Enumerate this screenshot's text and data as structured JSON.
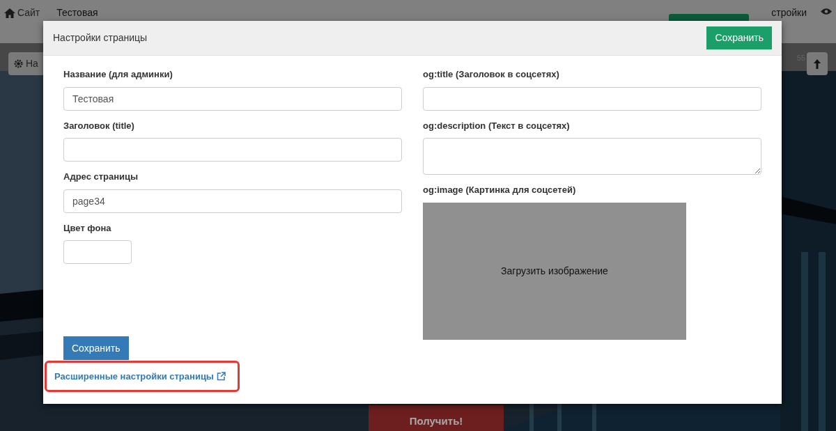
{
  "topbar": {
    "home": "Сайт",
    "page": "Тестовая",
    "settings": "стройки"
  },
  "toolbar": {
    "left_button": "На",
    "counter": "55"
  },
  "cta_button": "Получить!",
  "modal": {
    "title": "Настройки страницы",
    "header_button": "Сохранить",
    "left_fields": [
      {
        "kind": "input",
        "label": "Название (для админки)",
        "value": "Тестовая"
      },
      {
        "kind": "input",
        "label": "Заголовок (title)"
      },
      {
        "kind": "input",
        "label": "Адрес страницы",
        "value": "page34"
      },
      {
        "kind": "color",
        "label": "Цвет фона"
      }
    ],
    "right_fields": [
      {
        "kind": "input",
        "label": "og:title (Заголовок в соцсетях)"
      },
      {
        "kind": "textarea",
        "label": "og:description (Текст в соцсетях)"
      },
      {
        "label": "og:image (Картинка для соцсетей)",
        "value": "Загрузить изображение"
      }
    ],
    "save_button": "Сохранить",
    "advanced_link": "Расширенные настройки страницы"
  }
}
